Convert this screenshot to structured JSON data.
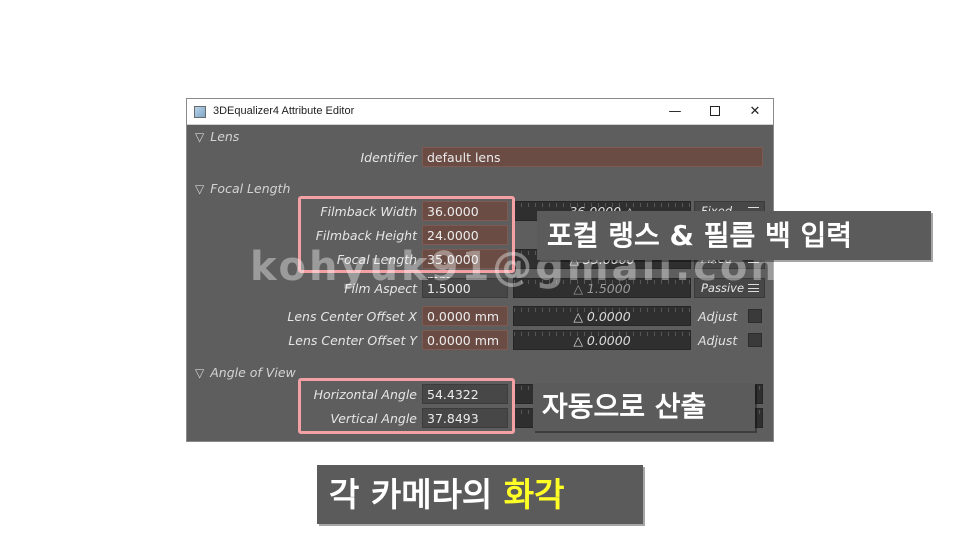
{
  "window": {
    "title": "3DEqualizer4 Attribute Editor",
    "minimize": "—",
    "close": "✕"
  },
  "lens": {
    "section": "Lens",
    "identifier_label": "Identifier",
    "identifier_value": "default lens"
  },
  "focal": {
    "section": "Focal Length",
    "filmback_width_label": "Filmback Width",
    "filmback_width_value": "36.0000 mm",
    "filmback_width_slider": "36.0000 △",
    "filmback_width_mode": "Fixed",
    "filmback_height_label": "Filmback Height",
    "filmback_height_value": "24.0000 mm",
    "focal_length_label": "Focal Length",
    "focal_length_value": "35.0000 mm",
    "focal_length_slider": "△ 35.0000",
    "focal_length_mode": "Fixed",
    "film_aspect_label": "Film Aspect",
    "film_aspect_value": "1.5000",
    "film_aspect_slider": "△ 1.5000",
    "film_aspect_mode": "Passive",
    "offset_x_label": "Lens Center Offset X",
    "offset_x_value": "0.0000 mm",
    "offset_x_slider": "△ 0.0000",
    "offset_x_adjust": "Adjust",
    "offset_y_label": "Lens Center Offset Y",
    "offset_y_value": "0.0000 mm",
    "offset_y_slider": "△ 0.0000",
    "offset_y_adjust": "Adjust"
  },
  "angle": {
    "section": "Angle of View",
    "horizontal_label": "Horizontal Angle",
    "horizontal_value": "54.4322",
    "vertical_label": "Vertical Angle",
    "vertical_value": "37.8493"
  },
  "overlay": {
    "watermark": "kohyuk91@gmail.com",
    "callout_input": "포컬 랭스 & 필름 백 입력",
    "callout_auto": "자동으로 산출",
    "caption_prefix": "각 카메라의 ",
    "caption_highlight": "화각",
    "highlight_color": "#ffff26",
    "box_color": "#f4a1a5"
  }
}
